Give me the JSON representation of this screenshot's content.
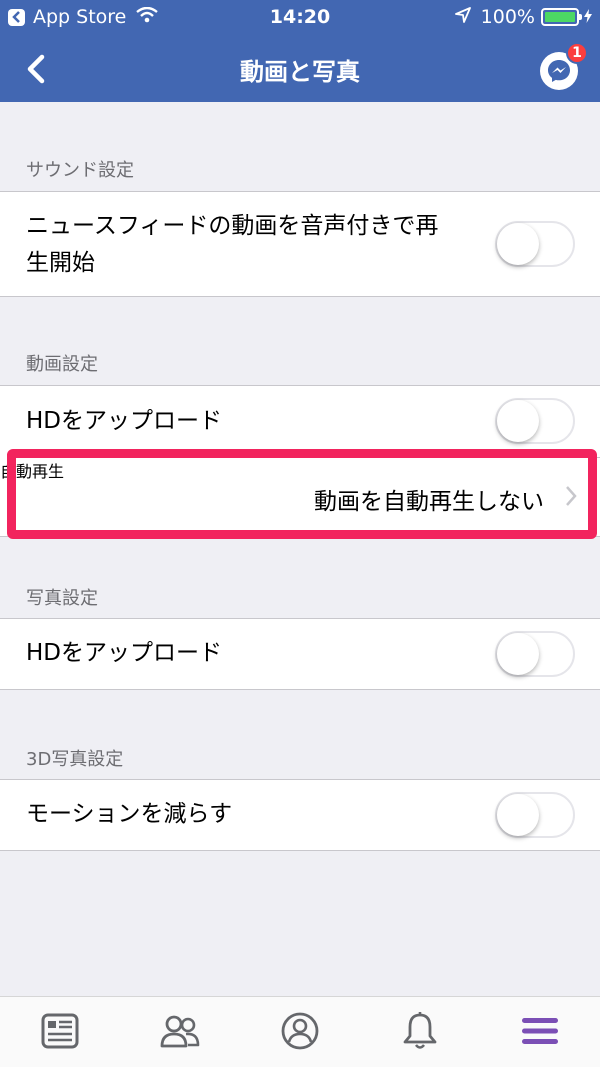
{
  "status_bar": {
    "carrier": "App Store",
    "time": "14:20",
    "battery": "100%"
  },
  "nav": {
    "title": "動画と写真",
    "messenger_badge": "1"
  },
  "sections": {
    "sound": {
      "header": "サウンド設定",
      "row_label": "ニュースフィードの動画を音声付きで再生開始",
      "row_label_line1": "ニュースフィードの動画を音声付きで再",
      "row_label_line2": "生開始",
      "toggle_on": false
    },
    "video": {
      "header": "動画設定",
      "hd_label": "HDをアップロード",
      "hd_toggle_on": false,
      "autoplay_label": "自動再生",
      "autoplay_value": "動画を自動再生しない"
    },
    "photo": {
      "header": "写真設定",
      "hd_label": "HDをアップロード",
      "hd_toggle_on": false
    },
    "photo3d": {
      "header": "3D写真設定",
      "motion_label": "モーションを減らす",
      "motion_toggle_on": false
    }
  },
  "tabs": [
    {
      "icon": "news-feed-icon"
    },
    {
      "icon": "friends-icon"
    },
    {
      "icon": "profile-icon"
    },
    {
      "icon": "notifications-bell-icon"
    },
    {
      "icon": "menu-icon",
      "active": true
    }
  ],
  "colors": {
    "header_blue": "#4267b2",
    "highlight": "#f2245e",
    "active_tab": "#7b4fb5"
  }
}
